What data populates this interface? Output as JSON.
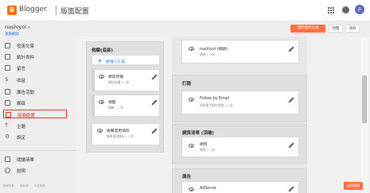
{
  "header": {
    "brand": "Blogger",
    "section": "版面配置"
  },
  "blog": {
    "name": "nashiyoi",
    "view_link": "查看網誌"
  },
  "toolbar": {
    "save": "儲存排列方式",
    "preview": "預覽",
    "clear": "清除"
  },
  "avatar_letter": "p",
  "sidebar": {
    "items": [
      {
        "label": "發表文章",
        "icon": "posts-icon"
      },
      {
        "label": "統計資料",
        "icon": "stats-icon"
      },
      {
        "label": "留言",
        "icon": "comments-icon"
      },
      {
        "label": "收益",
        "icon": "earnings-icon"
      },
      {
        "label": "廣告活動",
        "icon": "campaigns-icon"
      },
      {
        "label": "網頁",
        "icon": "pages-icon"
      },
      {
        "label": "版面配置",
        "icon": "layout-icon",
        "active": true
      },
      {
        "label": "主題",
        "icon": "theme-icon"
      },
      {
        "label": "設定",
        "icon": "settings-icon"
      }
    ],
    "bottom_items": [
      {
        "label": "閱讀清單",
        "icon": "reading-list-icon"
      },
      {
        "label": "說明",
        "icon": "help-icon"
      }
    ],
    "footer": [
      "服務條款",
      "隱私權",
      "內容政策"
    ]
  },
  "left_column": {
    "title": "側欄(底部)",
    "add_gadget": "新增小工具",
    "gadgets": [
      {
        "title": "網誌存檔",
        "sub": "網誌存檔 | 二次"
      },
      {
        "title": "標籤",
        "sub": "標籤 | 二次"
      },
      {
        "title": "檢舉濫用情形",
        "sub": "檢舉濫用情形 | 二次"
      }
    ]
  },
  "right_column": {
    "top_gadget": {
      "title": "nashiyoi (標頭)",
      "sub": "標頭 | 二次"
    },
    "sections": [
      {
        "title": "訂閱",
        "gadget": {
          "title": "Follow by Email",
          "sub": "透過電子郵件追蹤 | 二次"
        }
      },
      {
        "title": "網頁清單 (頂端)",
        "gadget": {
          "title": "網頁",
          "sub": "網頁 | 二次"
        }
      },
      {
        "title": "廣告",
        "gadget": {
          "title": "AdSense",
          "sub": ""
        }
      }
    ]
  },
  "back_to_top": "返回頂端",
  "colors": {
    "accent": "#ff7043",
    "active": "#d93025",
    "link": "#1a73e8"
  }
}
